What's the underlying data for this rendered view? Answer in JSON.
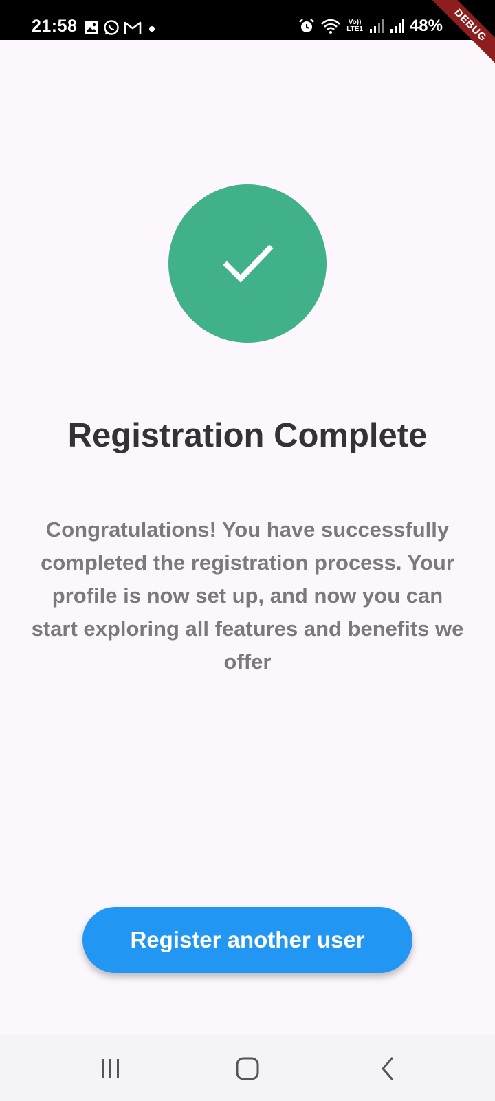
{
  "status_bar": {
    "time": "21:58",
    "battery": "48%",
    "left_icons": [
      "gallery-icon",
      "whatsapp-icon",
      "gmail-icon",
      "dot-icon"
    ],
    "right_icons": [
      "alarm-icon",
      "wifi-icon",
      "volte-icon",
      "signal-icon",
      "signal-icon"
    ],
    "volte_top": "Vo))",
    "volte_bottom": "LTE1"
  },
  "debug_banner": {
    "label": "DEBUG"
  },
  "success": {
    "icon": "check-icon",
    "color": "#40b188"
  },
  "title": "Registration Complete",
  "message": "Congratulations! You have successfully completed the registration process. Your profile is now set up, and now you can start exploring all  features and benefits we offer",
  "button": {
    "label": "Register another user",
    "color": "#2196f3"
  },
  "nav_bar": {
    "items": [
      "recents-icon",
      "home-icon",
      "back-icon"
    ]
  }
}
